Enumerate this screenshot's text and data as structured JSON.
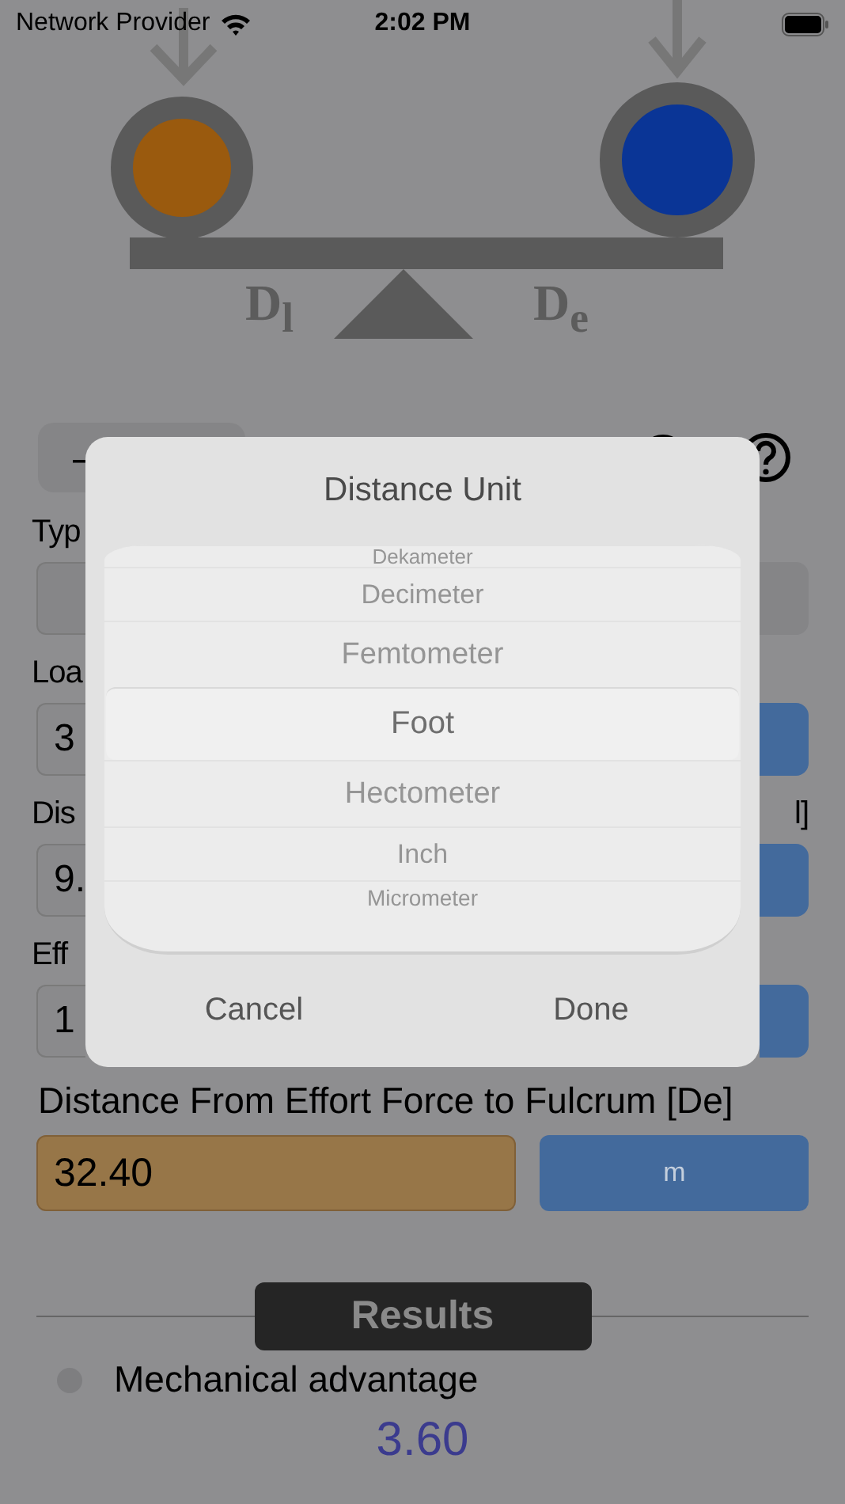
{
  "status_bar": {
    "carrier": "Network Provider",
    "time": "2:02 PM"
  },
  "diagram": {
    "load_label": "D$_{l}$",
    "effort_label": "D$_{e}$"
  },
  "toolbar": {
    "button_label": "–"
  },
  "form_rows": [
    {
      "label": "Typ",
      "label_tail": "",
      "value": "",
      "kind": "select"
    },
    {
      "label": "Loa",
      "label_tail": "",
      "value": "3",
      "kind": "input"
    },
    {
      "label": "Dis",
      "label_tail": "l]",
      "value": "9.",
      "kind": "input"
    },
    {
      "label": "Eff",
      "label_tail": "",
      "value": "1",
      "kind": "input"
    }
  ],
  "effort_distance": {
    "label": "Distance From Effort Force to Fulcrum [De]",
    "value": "32.40",
    "unit": "m"
  },
  "dialog": {
    "title": "Distance Unit",
    "options": [
      {
        "label": "Dekameter",
        "selected": false
      },
      {
        "label": "Decimeter",
        "selected": false
      },
      {
        "label": "Femtometer",
        "selected": false
      },
      {
        "label": "Foot",
        "selected": true
      },
      {
        "label": "Hectometer",
        "selected": false
      },
      {
        "label": "Inch",
        "selected": false
      },
      {
        "label": "Micrometer",
        "selected": false
      }
    ],
    "buttons": [
      "Cancel",
      "Done"
    ]
  },
  "results": {
    "heading": "Results",
    "items": [
      {
        "label": "Mechanical advantage",
        "value": "3.60",
        "selected": false
      }
    ]
  }
}
